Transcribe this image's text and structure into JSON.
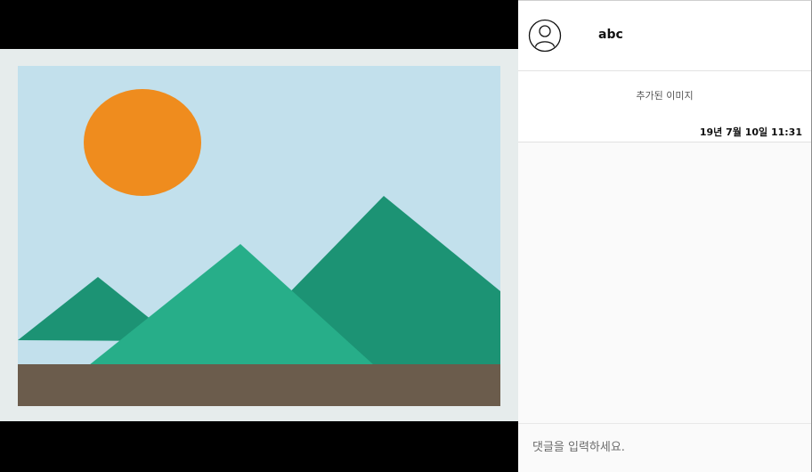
{
  "post": {
    "username": "abc",
    "caption": "추가된 이미지",
    "timestamp": "19년 7월 10일 11:31"
  },
  "comment": {
    "placeholder": "댓글을 입력하세요."
  },
  "icons": {
    "avatar": "user-avatar-icon",
    "image": "landscape-image-placeholder"
  },
  "colors": {
    "background_left": "#000000",
    "image_bg": "#e6ecec",
    "sky": "#c2e0ec",
    "sun": "#ef8c1e",
    "mountain_dark": "#1c9374",
    "mountain_light": "#27ae89",
    "ground": "#6b5c4c"
  }
}
